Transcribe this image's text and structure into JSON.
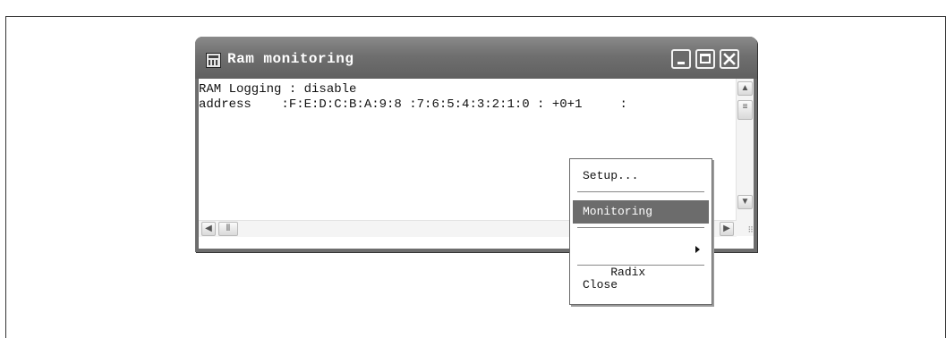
{
  "window": {
    "title": "Ram monitoring",
    "icon": "app-grid-icon"
  },
  "content": {
    "lines": [
      "RAM Logging : disable",
      "address    :F:E:D:C:B:A:9:8 :7:6:5:4:3:2:1:0 : +0+1     :"
    ]
  },
  "context_menu": {
    "items": [
      {
        "label": "Setup...",
        "selected": false
      },
      {
        "label": "Monitoring",
        "selected": true
      },
      {
        "label": "Radix",
        "selected": false,
        "has_submenu": true
      },
      {
        "label": "Close",
        "selected": false
      }
    ]
  },
  "colors": {
    "titlebar": "#6f6f6f",
    "menu_highlight": "#6c6c6c"
  }
}
